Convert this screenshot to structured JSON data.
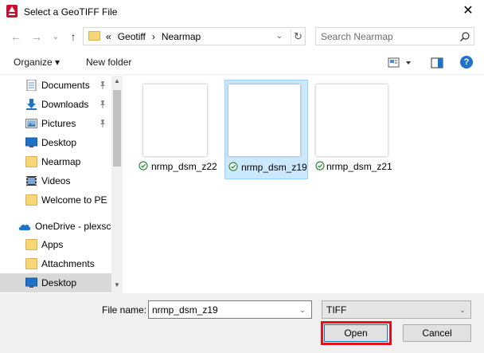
{
  "window": {
    "title": "Select a GeoTIFF File",
    "close_glyph": "✕"
  },
  "nav": {
    "back_glyph": "←",
    "forward_glyph": "→",
    "recent_glyph": "⌄",
    "up_glyph": "↑",
    "path_prefix": "«",
    "path": [
      "Geotiff",
      "Nearmap"
    ],
    "path_sep": "›",
    "dropdown_glyph": "⌄",
    "refresh_glyph": "↻",
    "search_placeholder": "Search Nearmap"
  },
  "toolbar": {
    "organize_label": "Organize ▾",
    "new_folder_label": "New folder",
    "help_glyph": "?"
  },
  "sidebar": {
    "items": [
      {
        "label": "Documents",
        "icon": "documents-icon",
        "pinned": true
      },
      {
        "label": "Downloads",
        "icon": "downloads-icon",
        "pinned": true
      },
      {
        "label": "Pictures",
        "icon": "pictures-icon",
        "pinned": true
      },
      {
        "label": "Desktop",
        "icon": "desktop-icon",
        "pinned": false
      },
      {
        "label": "Nearmap",
        "icon": "folder-icon",
        "pinned": false
      },
      {
        "label": "Videos",
        "icon": "videos-icon",
        "pinned": false
      },
      {
        "label": "Welcome to PE",
        "icon": "folder-icon",
        "pinned": false
      },
      {
        "label": "OneDrive - plexsc",
        "icon": "onedrive-icon",
        "pinned": false
      },
      {
        "label": "Apps",
        "icon": "folder-icon",
        "pinned": false
      },
      {
        "label": "Attachments",
        "icon": "folder-icon",
        "pinned": false
      },
      {
        "label": "Desktop",
        "icon": "desktop-icon",
        "pinned": false,
        "selected": true
      }
    ],
    "pin_glyph": "📌",
    "scroll_up_glyph": "▲",
    "scroll_down_glyph": "▼"
  },
  "files": [
    {
      "name": "nrmp_dsm_z22",
      "selected": false
    },
    {
      "name": "nrmp_dsm_z19",
      "selected": true
    },
    {
      "name": "nrmp_dsm_z21",
      "selected": false
    }
  ],
  "bottom": {
    "file_name_label": "File name:",
    "file_name_value": "nrmp_dsm_z19",
    "file_type_value": "TIFF",
    "dropdown_glyph": "⌄",
    "open_label": "Open",
    "cancel_label": "Cancel"
  },
  "colors": {
    "selection": "#cce8ff",
    "highlight_border": "#e2111d",
    "accent": "#0078d7"
  }
}
